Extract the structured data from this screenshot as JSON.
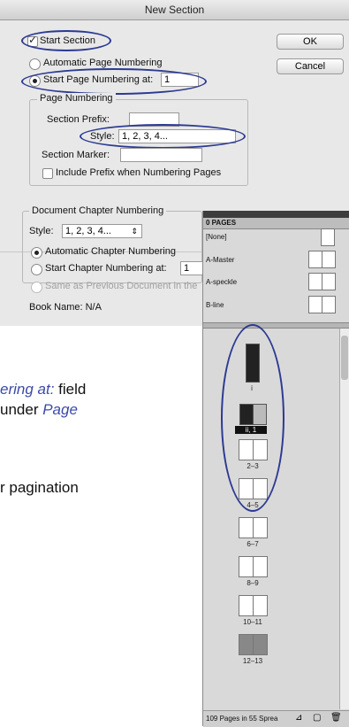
{
  "dialog": {
    "title": "New Section",
    "ok": "OK",
    "cancel": "Cancel",
    "start_section": "Start Section",
    "automatic_page_numbering": "Automatic Page Numbering",
    "start_page_numbering_at": "Start Page Numbering at:",
    "start_page_value": "1",
    "page_numbering_group": "Page Numbering",
    "section_prefix_label": "Section Prefix:",
    "style_label": "Style:",
    "style_value": "1, 2, 3, 4...",
    "section_marker_label": "Section Marker:",
    "include_prefix": "Include Prefix when Numbering Pages",
    "doc_chapter_group": "Document Chapter Numbering",
    "chapter_style_label": "Style:",
    "chapter_style_value": "1, 2, 3, 4...",
    "automatic_chapter_numbering": "Automatic Chapter Numbering",
    "start_chapter_numbering_at": "Start Chapter Numbering at:",
    "chapter_start_value": "1",
    "same_as_previous": "Same as Previous Document in the",
    "book_name": "Book Name: N/A"
  },
  "caption": {
    "line1_blue": "ering at:",
    "line1_rest": "field",
    "line2_rest": "under",
    "line2_blue": "Page",
    "line3": "r pagination"
  },
  "panel": {
    "title": "0 PAGES",
    "masters": [
      "[None]",
      "A-Master",
      "A-speckle",
      "B-line"
    ],
    "page_labels": [
      "i",
      "ii, 1",
      "2–3",
      "4–5",
      "6–7",
      "8–9",
      "10–11",
      "12–13"
    ],
    "footer": "109 Pages in 55 Sprea"
  },
  "colors": {
    "accent_oval": "#2c3a92",
    "caption_blue": "#3c4aa8"
  }
}
